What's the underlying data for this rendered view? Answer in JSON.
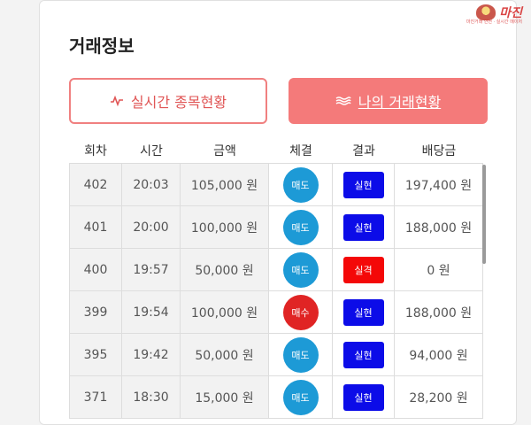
{
  "watermark": {
    "text": "마진",
    "sub": "마진거래 안전 · 실시간 메이저"
  },
  "title": "거래정보",
  "buttons": {
    "live_label": "실시간 종목현황",
    "mine_label": "나의 거래현황"
  },
  "columns": [
    "회차",
    "시간",
    "금액",
    "체결",
    "결과",
    "배당금"
  ],
  "rows": [
    {
      "round": "402",
      "time": "20:03",
      "amount": "105,000 원",
      "trade": "매도",
      "trade_type": "sell",
      "result": "실현",
      "result_type": "hit",
      "payout": "197,400 원"
    },
    {
      "round": "401",
      "time": "20:00",
      "amount": "100,000 원",
      "trade": "매도",
      "trade_type": "sell",
      "result": "실현",
      "result_type": "hit",
      "payout": "188,000 원"
    },
    {
      "round": "400",
      "time": "19:57",
      "amount": "50,000 원",
      "trade": "매도",
      "trade_type": "sell",
      "result": "실격",
      "result_type": "miss",
      "payout": "0 원"
    },
    {
      "round": "399",
      "time": "19:54",
      "amount": "100,000 원",
      "trade": "매수",
      "trade_type": "buy",
      "result": "실현",
      "result_type": "hit",
      "payout": "188,000 원"
    },
    {
      "round": "395",
      "time": "19:42",
      "amount": "50,000 원",
      "trade": "매도",
      "trade_type": "sell",
      "result": "실현",
      "result_type": "hit",
      "payout": "94,000 원"
    },
    {
      "round": "371",
      "time": "18:30",
      "amount": "15,000 원",
      "trade": "매도",
      "trade_type": "sell",
      "result": "실현",
      "result_type": "hit",
      "payout": "28,200 원"
    }
  ],
  "colors": {
    "accent": "#f47a7a",
    "sell": "#1d9ad6",
    "buy": "#e02424",
    "hit": "#0c0ce8",
    "miss": "#f40808"
  },
  "icons": {
    "live": "pulse-icon",
    "mine": "waves-icon"
  }
}
